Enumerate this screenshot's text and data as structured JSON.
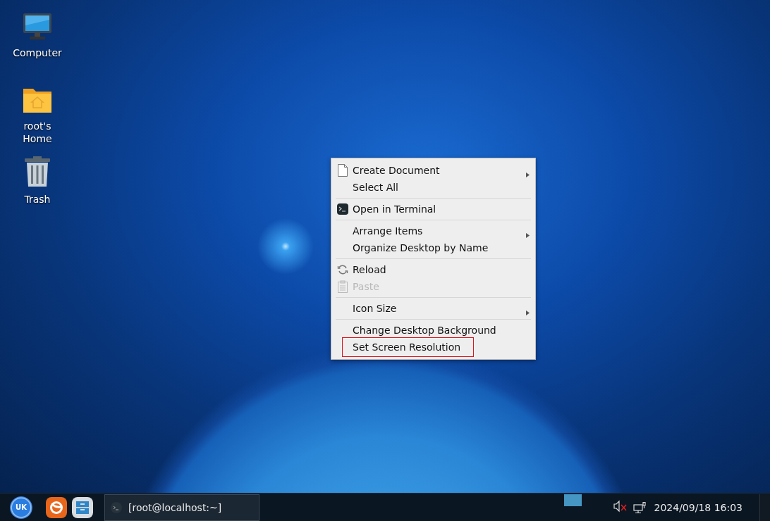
{
  "desktop_icons": [
    {
      "label": "Computer",
      "kind": "computer"
    },
    {
      "label": "root's Home",
      "kind": "home"
    },
    {
      "label": "Trash",
      "kind": "trash"
    }
  ],
  "context_menu": {
    "items": [
      {
        "kind": "document",
        "label": "Create Document",
        "submenu": true,
        "disabled": false,
        "outlined": false
      },
      {
        "kind": "item",
        "label": "Select All",
        "submenu": false,
        "disabled": false,
        "outlined": false
      },
      {
        "kind": "separator"
      },
      {
        "kind": "terminal",
        "label": "Open in Terminal",
        "submenu": false,
        "disabled": false,
        "outlined": false
      },
      {
        "kind": "separator"
      },
      {
        "kind": "item",
        "label": "Arrange Items",
        "submenu": true,
        "disabled": false,
        "outlined": false
      },
      {
        "kind": "item",
        "label": "Organize Desktop by Name",
        "submenu": false,
        "disabled": false,
        "outlined": false
      },
      {
        "kind": "separator"
      },
      {
        "kind": "reload",
        "label": "Reload",
        "submenu": false,
        "disabled": false,
        "outlined": false
      },
      {
        "kind": "paste",
        "label": "Paste",
        "submenu": false,
        "disabled": true,
        "outlined": false
      },
      {
        "kind": "separator"
      },
      {
        "kind": "item",
        "label": "Icon Size",
        "submenu": true,
        "disabled": false,
        "outlined": false
      },
      {
        "kind": "separator"
      },
      {
        "kind": "item",
        "label": "Change Desktop Background",
        "submenu": false,
        "disabled": false,
        "outlined": false
      },
      {
        "kind": "item",
        "label": "Set Screen Resolution",
        "submenu": false,
        "disabled": false,
        "outlined": true
      }
    ]
  },
  "taskbar": {
    "launcher": {
      "label": "UK"
    },
    "quick_launch": [
      {
        "kind": "browser"
      },
      {
        "kind": "files"
      }
    ],
    "task_button": {
      "label": "[root@localhost:~]"
    },
    "volume": {
      "muted": true
    },
    "clock": "2024/09/18 16:03"
  }
}
